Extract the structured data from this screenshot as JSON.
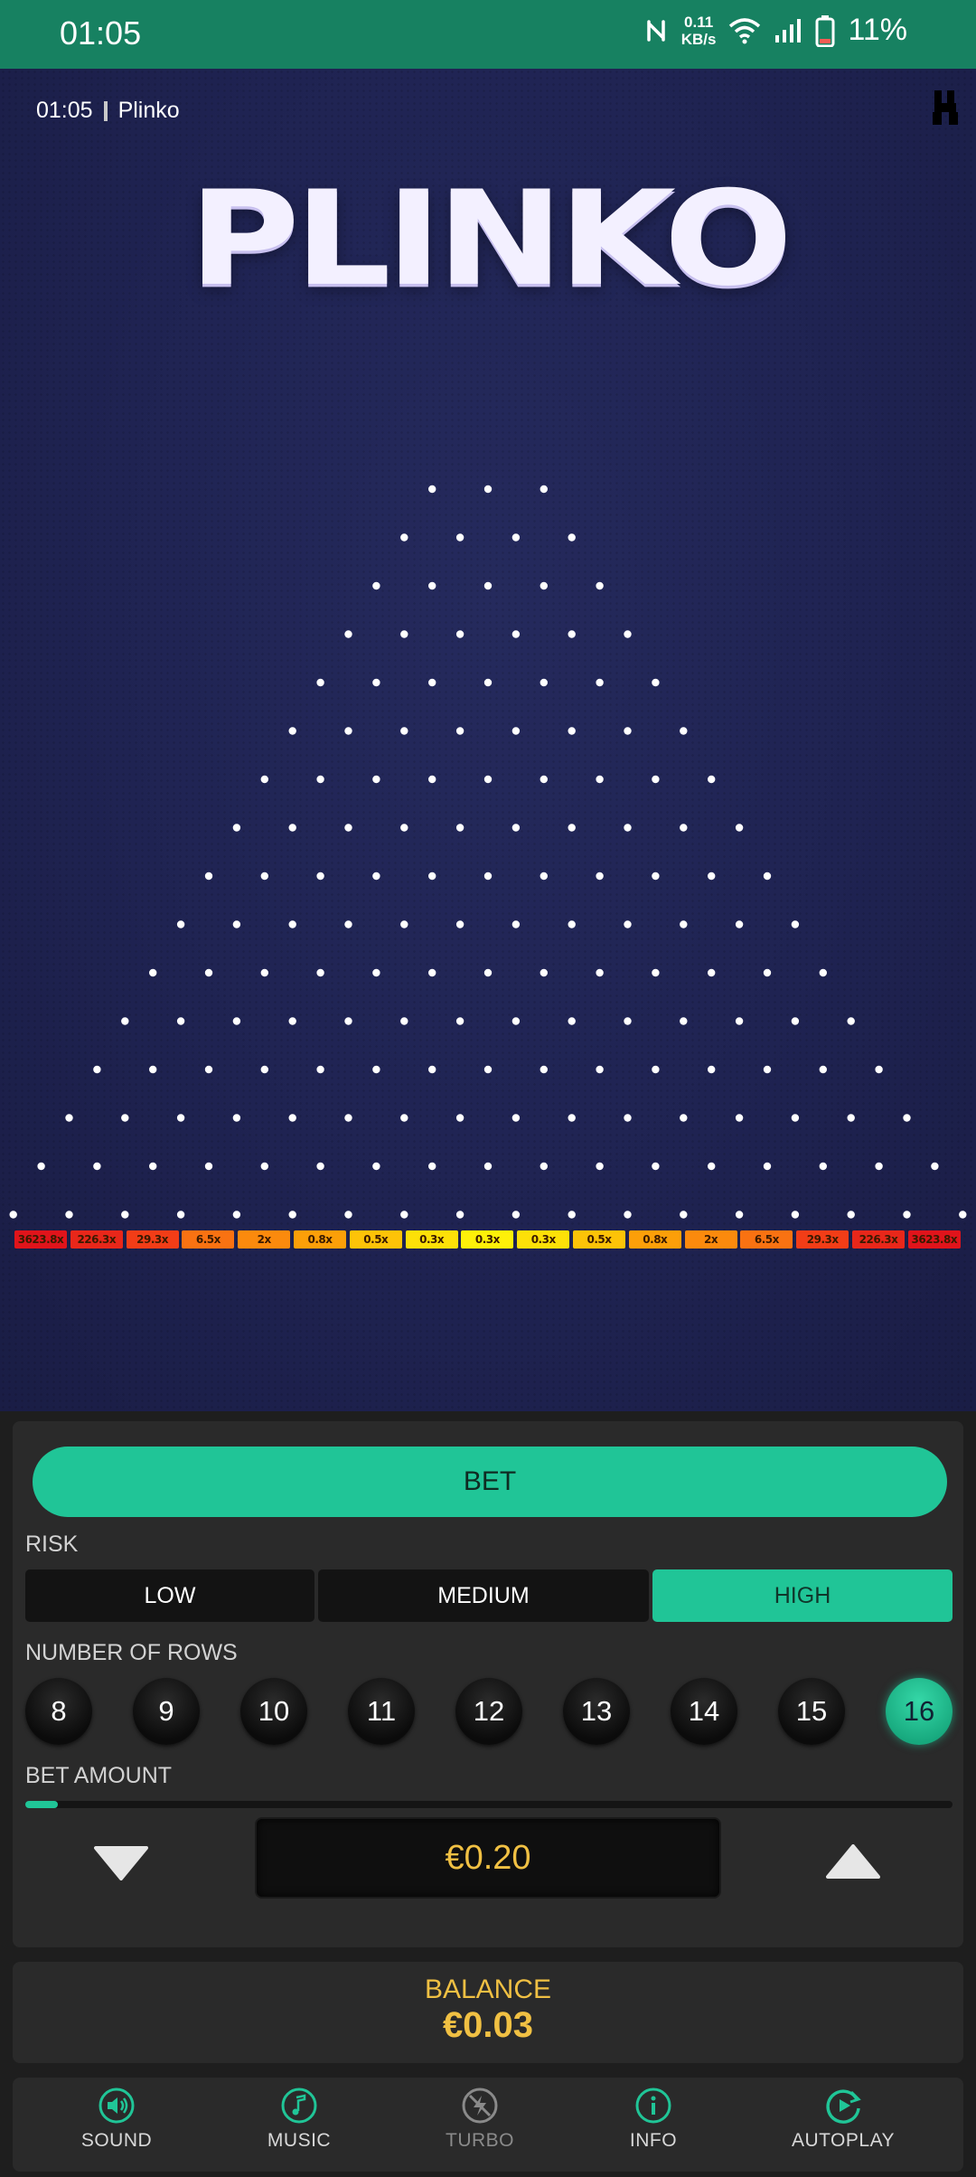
{
  "status_bar": {
    "time": "01:05",
    "net_speed_value": "0.11",
    "net_speed_unit": "KB/s",
    "battery": "11%",
    "icons": [
      "nfc-icon",
      "wifi-icon",
      "signal-icon",
      "battery-icon"
    ]
  },
  "game": {
    "clock": "01:05",
    "name": "Plinko",
    "logo": "PLINKO",
    "peg_rows": 16,
    "multipliers": [
      "3623.8x",
      "226.3x",
      "29.3x",
      "6.5x",
      "2x",
      "0.8x",
      "0.5x",
      "0.3x",
      "0.3x",
      "0.3x",
      "0.5x",
      "0.8x",
      "2x",
      "6.5x",
      "29.3x",
      "226.3x",
      "3623.8x"
    ],
    "multiplier_colors": [
      "#e0141b",
      "#e8271a",
      "#f23d17",
      "#f97212",
      "#fb8a0d",
      "#fc9f09",
      "#fdc308",
      "#fde008",
      "#fef009",
      "#fde008",
      "#fdc308",
      "#fc9f09",
      "#fb8a0d",
      "#f97212",
      "#f23d17",
      "#e8271a",
      "#e0141b"
    ]
  },
  "controls": {
    "bet_label": "BET",
    "risk_label": "RISK",
    "risk_options": [
      "LOW",
      "MEDIUM",
      "HIGH"
    ],
    "risk_selected": "HIGH",
    "rows_label": "NUMBER OF ROWS",
    "row_options": [
      "8",
      "9",
      "10",
      "11",
      "12",
      "13",
      "14",
      "15",
      "16"
    ],
    "rows_selected": "16",
    "bet_amount_label": "BET AMOUNT",
    "bet_amount_value": "€0.20",
    "bet_slider_level": 0.035
  },
  "balance": {
    "label": "BALANCE",
    "value": "€0.03"
  },
  "nav": {
    "sound": "SOUND",
    "music": "MUSIC",
    "turbo": "TURBO",
    "info": "INFO",
    "autoplay": "AUTOPLAY"
  },
  "colors": {
    "accent": "#20c597",
    "status_bar": "#178161",
    "gold": "#f0c043",
    "panel": "#2a2a2a"
  }
}
